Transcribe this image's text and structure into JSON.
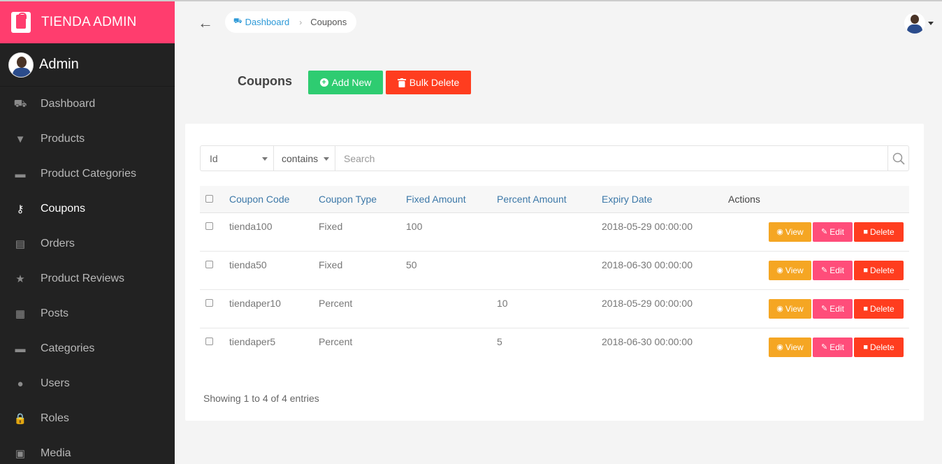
{
  "brand": {
    "title": "TIENDA ADMIN"
  },
  "user": {
    "name": "Admin"
  },
  "sidebar": {
    "items": [
      {
        "label": "Dashboard",
        "icon": "dashboard-icon",
        "glyph": "⛟",
        "active": false
      },
      {
        "label": "Products",
        "icon": "products-icon",
        "glyph": "▼",
        "active": false
      },
      {
        "label": "Product Categories",
        "icon": "folder-icon",
        "glyph": "▬",
        "active": false
      },
      {
        "label": "Coupons",
        "icon": "key-icon",
        "glyph": "⚷",
        "active": true
      },
      {
        "label": "Orders",
        "icon": "file-icon",
        "glyph": "▤",
        "active": false
      },
      {
        "label": "Product Reviews",
        "icon": "star-icon",
        "glyph": "★",
        "active": false
      },
      {
        "label": "Posts",
        "icon": "newspaper-icon",
        "glyph": "▦",
        "active": false
      },
      {
        "label": "Categories",
        "icon": "folder-icon",
        "glyph": "▬",
        "active": false
      },
      {
        "label": "Users",
        "icon": "user-icon",
        "glyph": "●",
        "active": false
      },
      {
        "label": "Roles",
        "icon": "lock-icon",
        "glyph": "🔒",
        "active": false
      },
      {
        "label": "Media",
        "icon": "image-icon",
        "glyph": "▣",
        "active": false
      }
    ]
  },
  "breadcrumb": {
    "home": "Dashboard",
    "current": "Coupons"
  },
  "page": {
    "title": "Coupons"
  },
  "toolbar": {
    "add_label": "Add New",
    "bulk_delete_label": "Bulk Delete"
  },
  "search": {
    "field": "Id",
    "operator": "contains",
    "placeholder": "Search"
  },
  "table": {
    "headers": [
      "Coupon Code",
      "Coupon Type",
      "Fixed Amount",
      "Percent Amount",
      "Expiry Date",
      "Actions"
    ],
    "rows": [
      {
        "code": "tienda100",
        "type": "Fixed",
        "fixed": "100",
        "percent": "",
        "expiry": "2018-05-29 00:00:00"
      },
      {
        "code": "tienda50",
        "type": "Fixed",
        "fixed": "50",
        "percent": "",
        "expiry": "2018-06-30 00:00:00"
      },
      {
        "code": "tiendaper10",
        "type": "Percent",
        "fixed": "",
        "percent": "10",
        "expiry": "2018-05-29 00:00:00"
      },
      {
        "code": "tiendaper5",
        "type": "Percent",
        "fixed": "",
        "percent": "5",
        "expiry": "2018-06-30 00:00:00"
      }
    ],
    "actions": {
      "view": "View",
      "edit": "Edit",
      "delete": "Delete"
    }
  },
  "footer": {
    "showing": "Showing 1 to 4 of 4 entries"
  },
  "colors": {
    "brand": "#ff3d6e",
    "sidebar": "#222222",
    "add": "#2ecc71",
    "danger": "#ff3d1f",
    "view": "#f5a623",
    "edit": "#ff4d7a",
    "link": "#3c78a8"
  }
}
